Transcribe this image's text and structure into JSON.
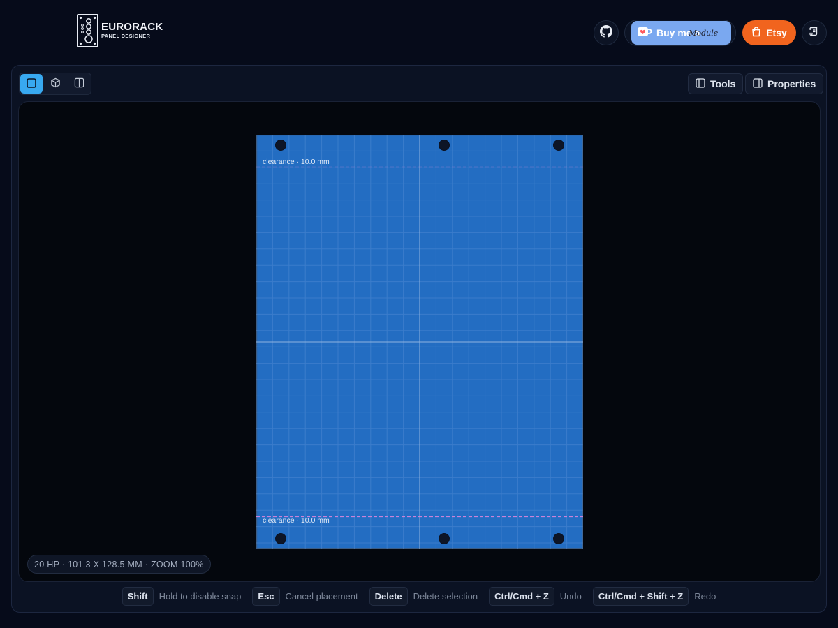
{
  "header": {
    "logo_title": "EURORACK",
    "logo_subtitle": "PANEL DESIGNER",
    "buy_me_label": "Buy me a",
    "buy_me_script": "Module",
    "etsy_label": "Etsy"
  },
  "toolbar": {
    "tools_label": "Tools",
    "properties_label": "Properties"
  },
  "canvas": {
    "clearance_top": "clearance · 10.0 mm",
    "clearance_bottom": "clearance · 10.0 mm",
    "status": "20 HP · 101.3 X 128.5 MM · ZOOM 100%"
  },
  "shortcuts": [
    {
      "key": "Shift",
      "label": "Hold to disable snap"
    },
    {
      "key": "Esc",
      "label": "Cancel placement"
    },
    {
      "key": "Delete",
      "label": "Delete selection"
    },
    {
      "key": "Ctrl/Cmd + Z",
      "label": "Undo"
    },
    {
      "key": "Ctrl/Cmd + Shift + Z",
      "label": "Redo"
    }
  ],
  "colors": {
    "panel_fill": "#236dc2",
    "accent": "#38a9f0",
    "etsy": "#f1641e",
    "clearance_line": "#c983d9"
  }
}
